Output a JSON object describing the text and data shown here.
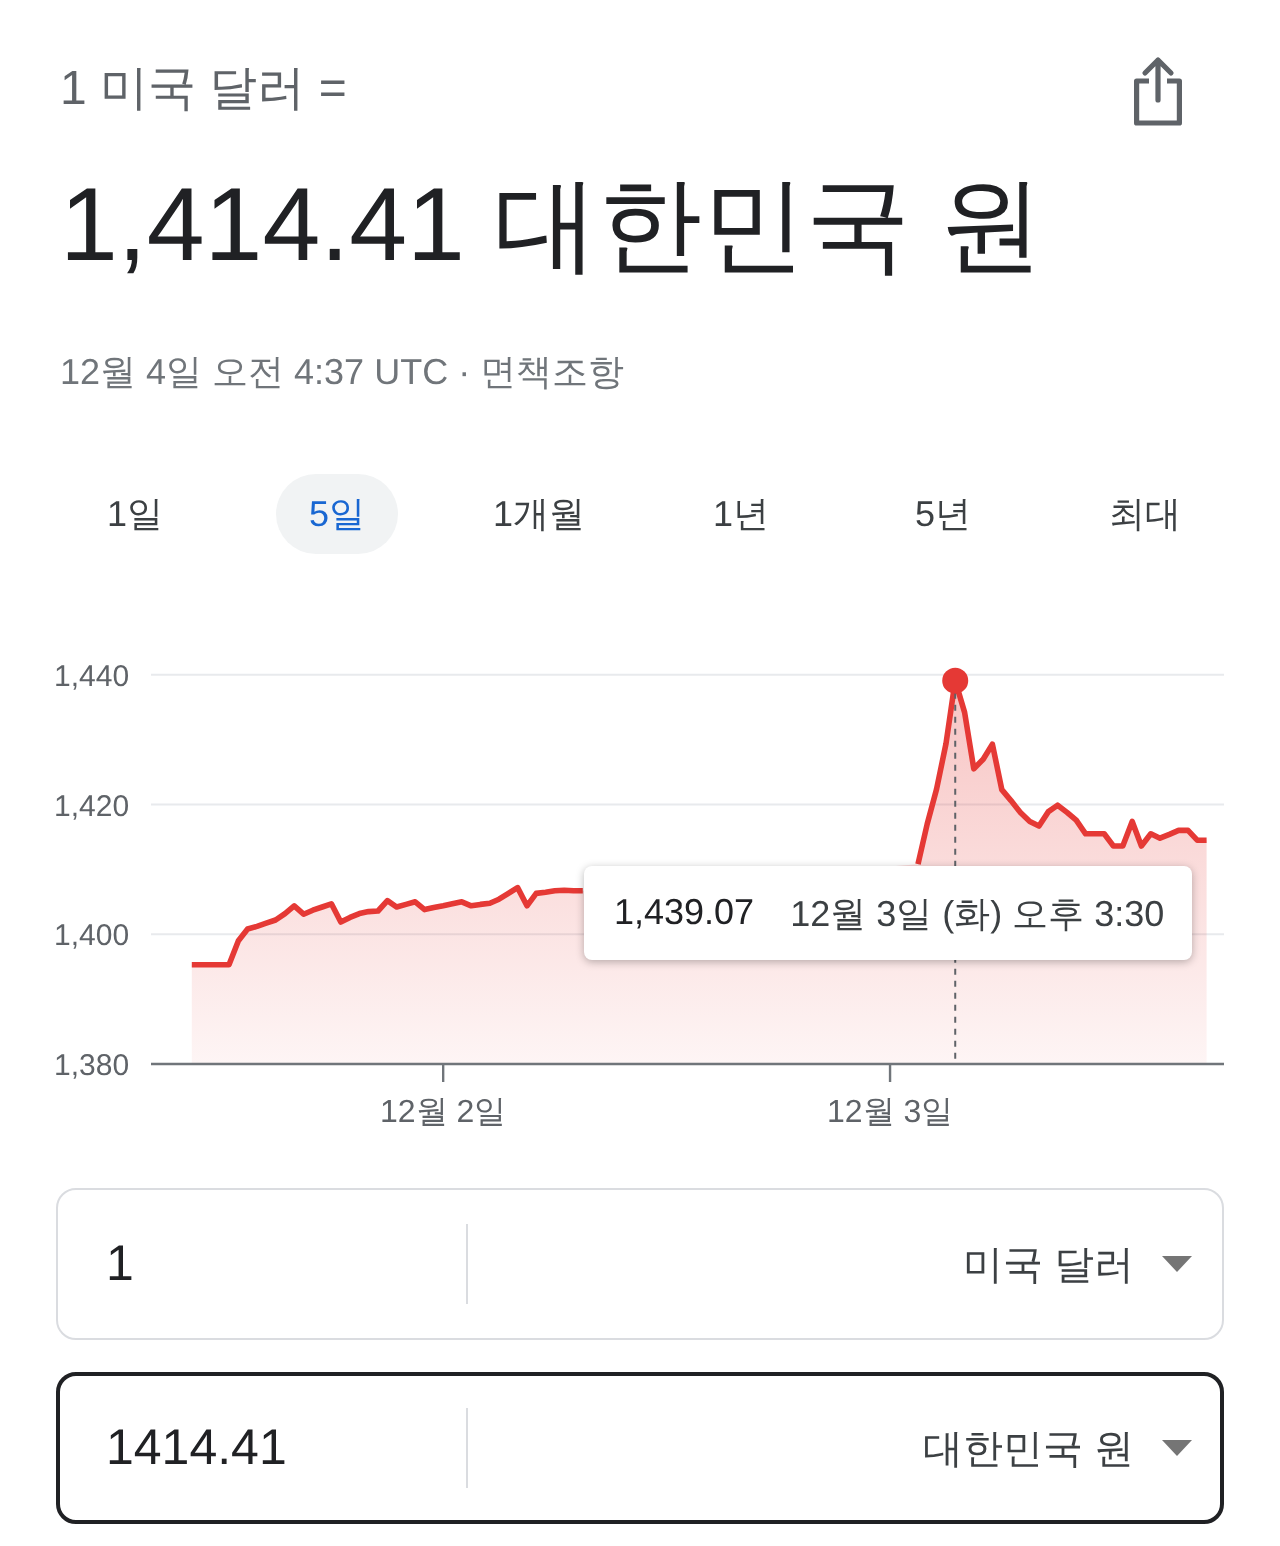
{
  "header": {
    "title": "1 미국 달러 ="
  },
  "result": {
    "value": "1,414.41 대한민국 원"
  },
  "timestamp": {
    "text": "12월 4일 오전 4:37 UTC ·",
    "disclaimer": "면책조항"
  },
  "range_tabs": [
    {
      "label": "1일",
      "selected": false
    },
    {
      "label": "5일",
      "selected": true
    },
    {
      "label": "1개월",
      "selected": false
    },
    {
      "label": "1년",
      "selected": false
    },
    {
      "label": "5년",
      "selected": false
    },
    {
      "label": "최대",
      "selected": false
    }
  ],
  "chart": {
    "chart_data": {
      "type": "area",
      "categories": [
        null,
        null,
        null,
        null,
        null,
        null,
        null,
        null,
        null,
        null,
        null,
        null,
        null,
        null,
        null,
        null,
        null,
        null,
        null,
        null,
        null,
        null,
        null,
        null,
        null,
        null,
        null,
        "12월 2일",
        null,
        null,
        null,
        null,
        null,
        null,
        null,
        null,
        null,
        null,
        null,
        null,
        null,
        null,
        null,
        null,
        null,
        null,
        null,
        null,
        null,
        null,
        null,
        null,
        null,
        null,
        null,
        null,
        null,
        null,
        null,
        null,
        null,
        null,
        null,
        null,
        null,
        null,
        null,
        null,
        null,
        null,
        null,
        null,
        null,
        null,
        null,
        "12월 3일",
        null,
        null,
        null,
        null,
        null,
        null,
        null,
        null,
        null,
        null,
        null,
        null,
        null,
        null,
        null,
        null,
        null,
        null,
        null,
        null,
        null,
        null,
        null,
        null,
        null,
        null,
        null,
        null,
        null,
        null,
        null,
        null,
        null,
        null
      ],
      "series": [
        {
          "color": "#e53935",
          "values": [
            1395.3,
            1395.3,
            1395.3,
            1395.3,
            1395.3,
            1399.0,
            1400.8,
            1401.2,
            1401.7,
            1402.2,
            1403.2,
            1404.4,
            1403.1,
            1403.7,
            1404.2,
            1404.7,
            1401.9,
            1402.6,
            1403.2,
            1403.5,
            1403.6,
            1405.2,
            1404.2,
            1404.6,
            1405.0,
            1403.8,
            1404.1,
            1404.4,
            1404.7,
            1405.0,
            1404.4,
            1404.6,
            1404.8,
            1405.4,
            1406.3,
            1407.2,
            1404.4,
            1406.3,
            1406.5,
            1406.7,
            1406.8,
            1406.7,
            1406.7,
            null,
            null,
            null,
            null,
            null,
            null,
            null,
            null,
            null,
            null,
            null,
            null,
            null,
            null,
            null,
            null,
            null,
            null,
            null,
            null,
            null,
            null,
            null,
            null,
            null,
            null,
            null,
            null,
            null,
            null,
            null,
            null,
            null,
            null,
            null,
            1410.8,
            1417.0,
            1422.4,
            1429.4,
            1439.1,
            1434.2,
            1425.5,
            1427.0,
            1429.3,
            1422.3,
            1420.6,
            1418.8,
            1417.4,
            1416.7,
            1418.9,
            1419.9,
            1418.8,
            1417.6,
            1415.5,
            1415.5,
            1415.5,
            1413.6,
            1413.6,
            1417.4,
            1413.6,
            1415.5,
            1414.8,
            1415.4,
            1416.0,
            1416.0,
            1414.5,
            1414.5
          ]
        }
      ],
      "ylim": [
        1380,
        1440
      ],
      "yticks": [
        {
          "value": 1380,
          "label": "1,380"
        },
        {
          "value": 1400,
          "label": "1,400"
        },
        {
          "value": 1420,
          "label": "1,420"
        },
        {
          "value": 1440,
          "label": "1,440"
        }
      ]
    },
    "tooltip": {
      "value": "1,439.07",
      "time": "12월 3일 (화) 오후 3:30"
    }
  },
  "converter": [
    {
      "amount": "1",
      "currency": "미국 달러",
      "focused": false
    },
    {
      "amount": "1414.41",
      "currency": "대한민국 원",
      "focused": true
    }
  ]
}
